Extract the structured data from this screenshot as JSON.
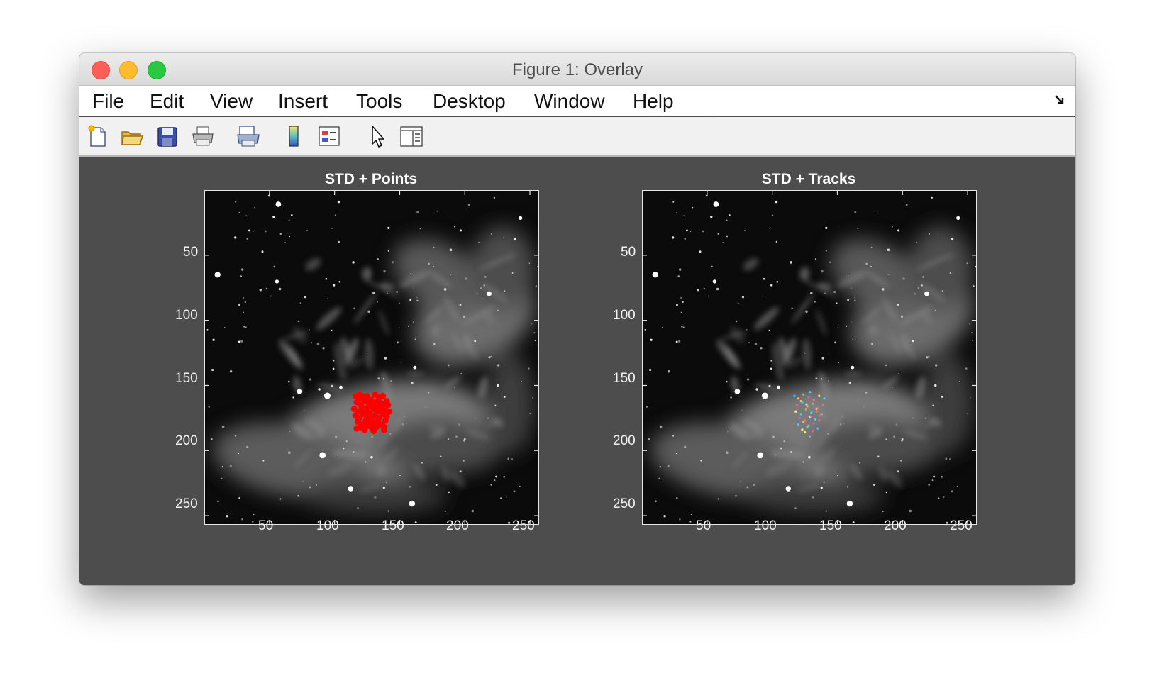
{
  "window": {
    "title": "Figure 1: Overlay"
  },
  "menu": [
    "File",
    "Edit",
    "View",
    "Insert",
    "Tools",
    "Desktop",
    "Window",
    "Help"
  ],
  "toolbar": {
    "tools": [
      "new-file-icon",
      "open-folder-icon",
      "save-icon",
      "print-icon",
      "print-preview-icon",
      "colorbar-icon",
      "legend-icon",
      "pointer-icon",
      "property-inspector-icon"
    ]
  },
  "colors": {
    "figure_bg": "#4d4d4d",
    "points": "#ff0000"
  },
  "axes": [
    {
      "title": "STD + Points",
      "xticks": [
        "50",
        "100",
        "150",
        "200",
        "250"
      ],
      "yticks": [
        "50",
        "100",
        "150",
        "200",
        "250"
      ]
    },
    {
      "title": "STD + Tracks",
      "xticks": [
        "50",
        "100",
        "150",
        "200",
        "250"
      ],
      "yticks": [
        "50",
        "100",
        "150",
        "200",
        "250"
      ]
    }
  ],
  "chart_data": [
    {
      "type": "scatter",
      "title": "STD + Points",
      "xlim": [
        0.5,
        256.5
      ],
      "ylim": [
        0.5,
        256.5
      ],
      "y_reversed": true,
      "x_ticks": [
        50,
        100,
        150,
        200,
        250
      ],
      "y_ticks": [
        50,
        100,
        150,
        200,
        250
      ],
      "series": [
        {
          "color": "#ff0000",
          "x": [
            116,
            119,
            122,
            125,
            128,
            131,
            134,
            137,
            140,
            117,
            120,
            123,
            126,
            129,
            132,
            135,
            138,
            141,
            115,
            118,
            121,
            124,
            127,
            130,
            133,
            136,
            139,
            142,
            116,
            119,
            122,
            125,
            128,
            131,
            134,
            137,
            140,
            118,
            121,
            124,
            127,
            130,
            133,
            136,
            139,
            117,
            120,
            123,
            126,
            129,
            132,
            135,
            138,
            119,
            122,
            125,
            128,
            131,
            134,
            137,
            121,
            124,
            127,
            130,
            133,
            136,
            118,
            126,
            132,
            138
          ],
          "y": [
            158,
            157,
            160,
            158,
            161,
            157,
            159,
            158,
            162,
            163,
            165,
            162,
            166,
            164,
            163,
            166,
            164,
            165,
            168,
            170,
            167,
            169,
            171,
            168,
            170,
            167,
            169,
            170,
            173,
            175,
            172,
            174,
            176,
            173,
            175,
            172,
            174,
            178,
            180,
            177,
            179,
            181,
            178,
            180,
            177,
            183,
            182,
            184,
            181,
            183,
            182,
            180,
            184,
            160,
            170,
            175,
            165,
            178,
            162,
            172,
            158,
            180,
            162,
            185,
            166,
            170,
            176,
            173,
            169,
            182
          ]
        }
      ]
    },
    {
      "type": "scatter",
      "title": "STD + Tracks",
      "xlim": [
        0.5,
        256.5
      ],
      "ylim": [
        0.5,
        256.5
      ],
      "y_reversed": true,
      "x_ticks": [
        50,
        100,
        150,
        200,
        250
      ],
      "y_ticks": [
        50,
        100,
        150,
        200,
        250
      ],
      "series": [
        {
          "color": "multicolor",
          "x": [
            117,
            120,
            124,
            128,
            132,
            136,
            140,
            119,
            123,
            127,
            131,
            135,
            139,
            118,
            122,
            126,
            130,
            134,
            138,
            121,
            125,
            129,
            133,
            137,
            120,
            124,
            128,
            132,
            136,
            123,
            127,
            131,
            135,
            122,
            126,
            130,
            134,
            125,
            129
          ],
          "y": [
            158,
            160,
            157,
            159,
            161,
            158,
            160,
            165,
            163,
            166,
            164,
            167,
            165,
            170,
            172,
            169,
            171,
            168,
            172,
            175,
            177,
            174,
            176,
            173,
            180,
            178,
            181,
            179,
            177,
            184,
            182,
            185,
            183,
            162,
            168,
            174,
            170,
            186,
            155
          ]
        }
      ]
    }
  ]
}
